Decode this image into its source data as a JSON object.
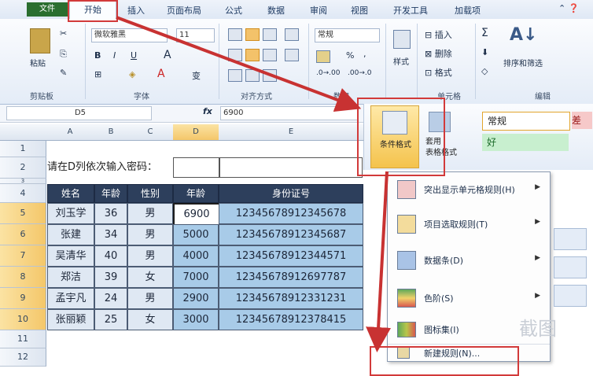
{
  "tabs": [
    "文件",
    "开始",
    "插入",
    "页面布局",
    "公式",
    "数据",
    "审阅",
    "视图",
    "开发工具",
    "加载项"
  ],
  "help_glyph": "⌃ ❓",
  "ribbon": {
    "font_name": "微软雅黑",
    "font_size": "11",
    "number_format": "常规",
    "percent": "%",
    "comma": ",",
    "paste": "粘贴",
    "styles": "样式",
    "cell_insert": "插入",
    "cell_delete": "删除",
    "cell_format": "格式",
    "sort_filter": "排序和筛选",
    "groups": [
      "剪贴板",
      "字体",
      "对齐方式",
      "数字",
      "单元格",
      "编辑"
    ],
    "bold": "B",
    "italic": "I",
    "underline": "U",
    "font_a": "A",
    "wen": "变",
    "sum": "Σ"
  },
  "name_box": "D5",
  "fx": "fx",
  "formula_value": "6900",
  "styles_panel": {
    "cond_format": "条件格式",
    "table_format": "套用\n表格格式",
    "normal": "常规",
    "good": "好",
    "bad": "差"
  },
  "columns": [
    "A",
    "B",
    "C",
    "D",
    "E"
  ],
  "rows": [
    "1",
    "2",
    "3",
    "4",
    "5",
    "6",
    "7",
    "8",
    "9",
    "10",
    "11",
    "12"
  ],
  "prompt_text": "请在D列依次输入密码：",
  "table": {
    "headers": [
      "姓名",
      "年龄",
      "性别",
      "年龄",
      "身份证号"
    ],
    "rows": [
      [
        "刘玉学",
        "36",
        "男",
        "6900",
        "12345678912345678"
      ],
      [
        "张建",
        "34",
        "男",
        "5000",
        "12345678912345687"
      ],
      [
        "吴清华",
        "40",
        "男",
        "4000",
        "12345678912344571"
      ],
      [
        "郑洁",
        "39",
        "女",
        "7000",
        "12345678912697787"
      ],
      [
        "孟宇凡",
        "24",
        "男",
        "2900",
        "12345678912331231"
      ],
      [
        "张丽颖",
        "25",
        "女",
        "3000",
        "12345678912378415"
      ]
    ]
  },
  "menu": [
    {
      "label": "突出显示单元格规则(H)",
      "arrow": "▶",
      "color": "#c23a3a"
    },
    {
      "label": "项目选取规则(T)",
      "arrow": "▶",
      "color": "#d9a93a"
    },
    {
      "label": "数据条(D)",
      "arrow": "▶",
      "color": "#4a78b8"
    },
    {
      "label": "色阶(S)",
      "arrow": "▶",
      "color": "#5fa85a"
    },
    {
      "label": "图标集(I)",
      "arrow": "▶",
      "color": "#b8c64a"
    },
    {
      "label": "新建规则(N)...",
      "arrow": "",
      "color": "#d8c48a"
    }
  ],
  "watermark": "截图"
}
